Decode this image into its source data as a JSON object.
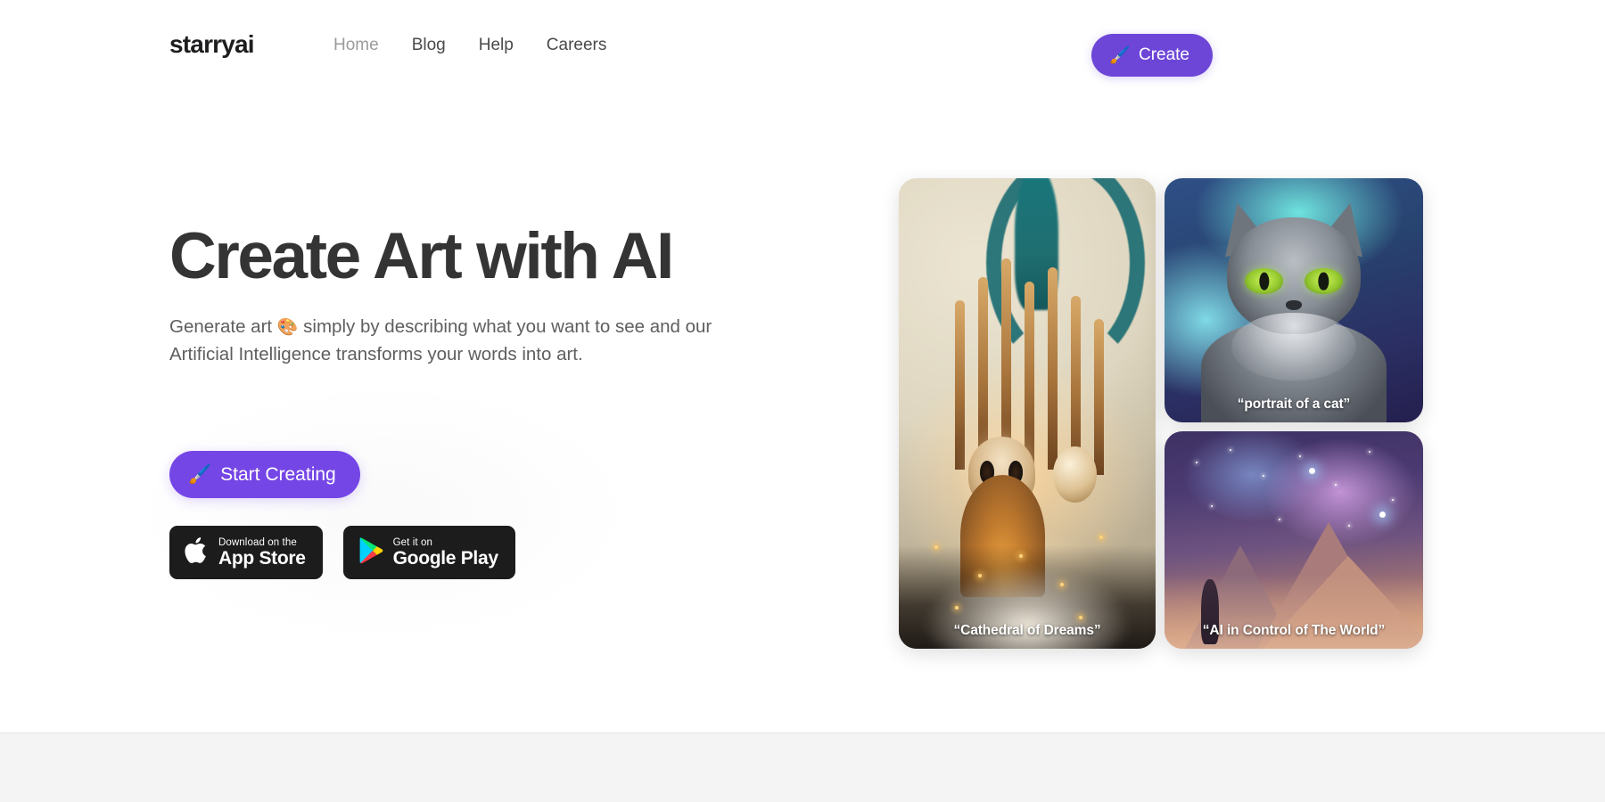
{
  "header": {
    "logo": "starryai",
    "nav": [
      {
        "label": "Home",
        "active": true
      },
      {
        "label": "Blog",
        "active": false
      },
      {
        "label": "Help",
        "active": false
      },
      {
        "label": "Careers",
        "active": false
      }
    ],
    "create_button": {
      "label": "Create",
      "icon": "paintbrush-emoji",
      "glyph": "🖌️",
      "color": "#6d46d7"
    }
  },
  "hero": {
    "title": "Create Art with AI",
    "subtitle_line1_before": "Generate art",
    "subtitle_emoji": "🎨",
    "subtitle_line1_after": "simply by describing what you want to see",
    "subtitle_line2": "and our Artificial Intelligence transforms your words into art.",
    "cta": {
      "label": "Start Creating",
      "icon": "paintbrush-emoji",
      "glyph": "🖌️",
      "color": "#7546e6"
    },
    "stores": [
      {
        "icon": "apple-logo-icon",
        "small": "Download on the",
        "large": "App Store"
      },
      {
        "icon": "google-play-icon",
        "small": "Get it on",
        "large": "Google Play"
      }
    ]
  },
  "gallery": {
    "cards": [
      {
        "caption": "“Cathedral of Dreams”",
        "name": "gallery-card-cathedral"
      },
      {
        "caption": "“portrait of a cat”",
        "name": "gallery-card-cat"
      },
      {
        "caption": "“AI in Control of The World”",
        "name": "gallery-card-space"
      }
    ]
  },
  "colors": {
    "page_background": "#ffffff",
    "footer_band": "#f4f4f4",
    "accent_purple": "#7546e6",
    "heading": "#343434",
    "body_text": "#5e5e5e",
    "badge_black": "#1c1c1c"
  }
}
